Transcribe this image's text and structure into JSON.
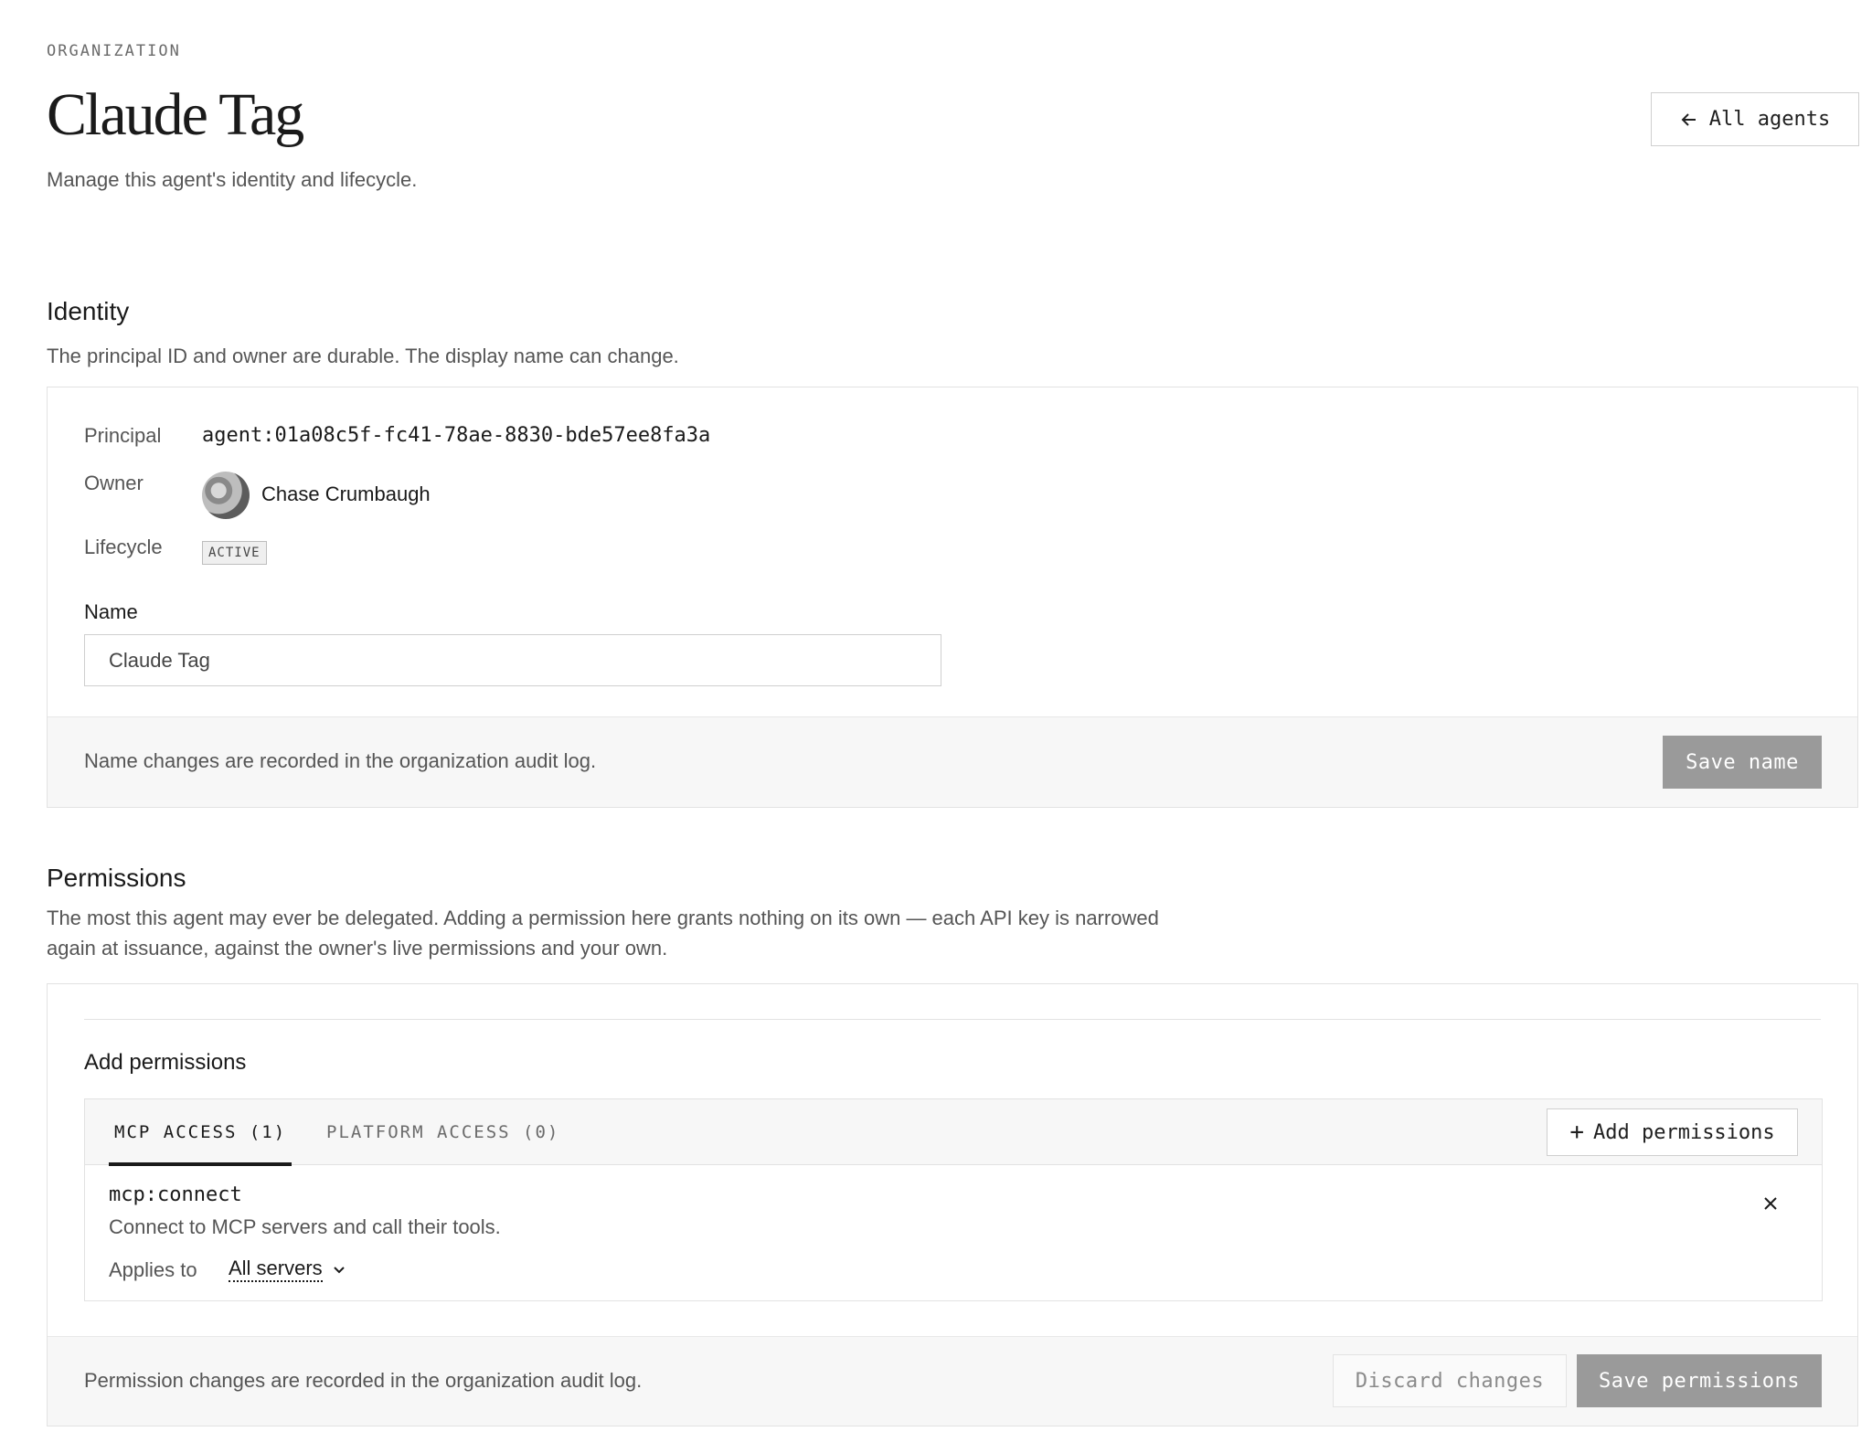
{
  "header": {
    "eyebrow": "ORGANIZATION",
    "title": "Claude Tag",
    "subtitle": "Manage this agent's identity and lifecycle.",
    "back_label": "All agents"
  },
  "identity": {
    "title": "Identity",
    "description": "The principal ID and owner are durable. The display name can change.",
    "principal_label": "Principal",
    "principal_value": "agent:01a08c5f-fc41-78ae-8830-bde57ee8fa3a",
    "owner_label": "Owner",
    "owner_name": "Chase Crumbaugh",
    "lifecycle_label": "Lifecycle",
    "lifecycle_value": "ACTIVE",
    "name_label": "Name",
    "name_value": "Claude Tag",
    "footer_text": "Name changes are recorded in the organization audit log.",
    "save_label": "Save name"
  },
  "permissions": {
    "title": "Permissions",
    "description_line1": "The most this agent may ever be delegated. Adding a permission here grants nothing on its own — each API key is narrowed",
    "description_line2": "again at issuance, against the owner's live permissions and your own.",
    "add_heading": "Add permissions",
    "tabs": [
      {
        "label": "MCP ACCESS (1)",
        "active": true
      },
      {
        "label": "PLATFORM ACCESS (0)",
        "active": false
      }
    ],
    "add_button_label": "Add permissions",
    "items": [
      {
        "name": "mcp:connect",
        "description": "Connect to MCP servers and call their tools.",
        "applies_label": "Applies to",
        "applies_value": "All servers"
      }
    ],
    "footer_text": "Permission changes are recorded in the organization audit log.",
    "discard_label": "Discard changes",
    "save_label": "Save permissions"
  },
  "colors": {
    "disabled_button": "#9a9a9a",
    "border": "#e2e2e2",
    "footer_bg": "#f7f7f7"
  }
}
